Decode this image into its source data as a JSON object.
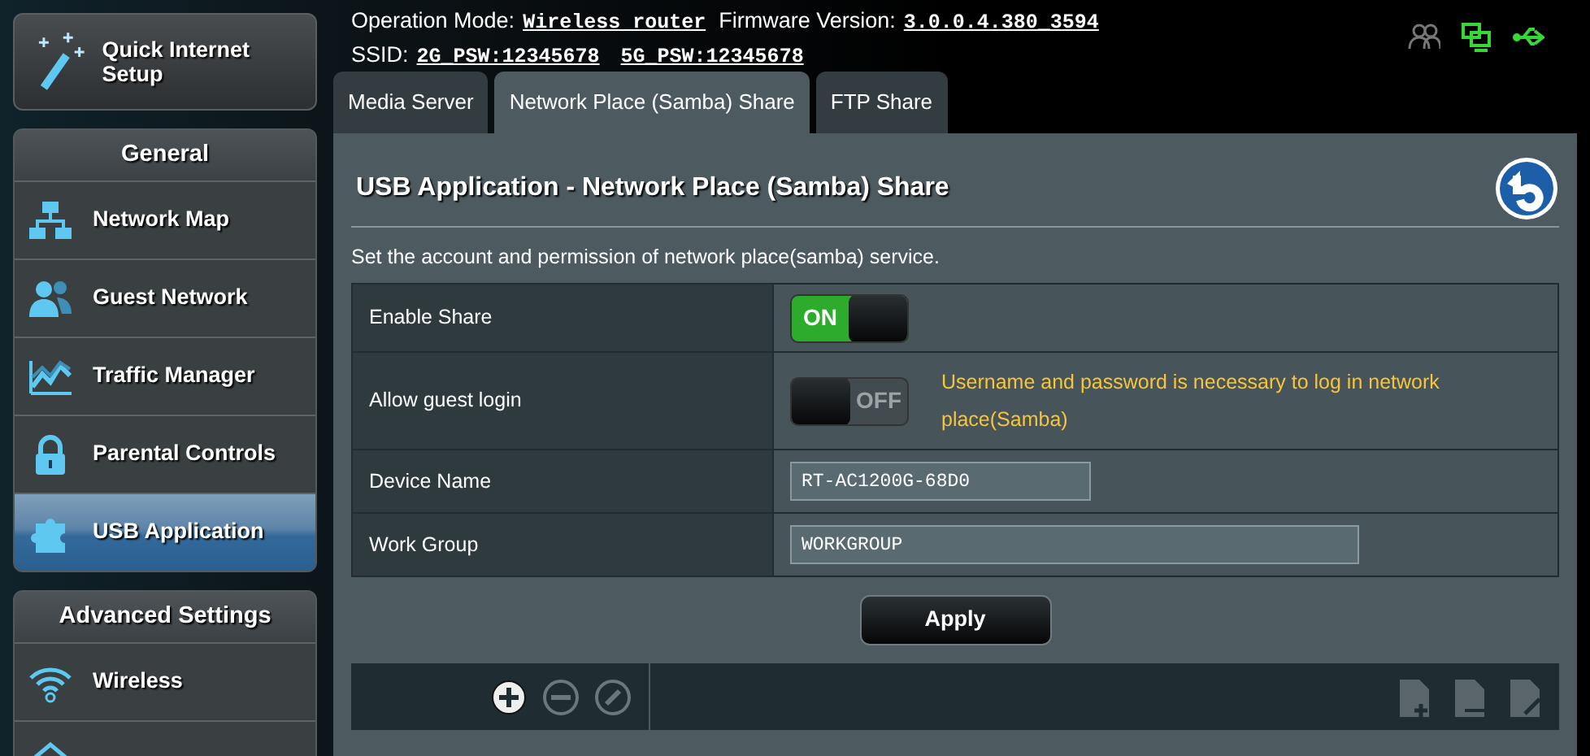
{
  "header": {
    "mode_label": "Operation Mode:",
    "mode_value": "Wireless router",
    "firmware_label": "Firmware Version:",
    "firmware_value": "3.0.0.4.380_3594",
    "ssid_label": "SSID:",
    "ssids": [
      "2G_PSW:12345678",
      "5G_PSW:12345678"
    ],
    "status_icons": [
      {
        "connected": false
      },
      {
        "connected": true
      },
      {
        "connected": true
      }
    ]
  },
  "sidebar": {
    "quick_setup": "Quick Internet Setup",
    "sections": [
      {
        "title": "General",
        "items": [
          {
            "label": "Network Map",
            "selected": false
          },
          {
            "label": "Guest Network",
            "selected": false
          },
          {
            "label": "Traffic Manager",
            "selected": false
          },
          {
            "label": "Parental Controls",
            "selected": false
          },
          {
            "label": "USB Application",
            "selected": true
          }
        ]
      },
      {
        "title": "Advanced Settings",
        "items": [
          {
            "label": "Wireless",
            "selected": false
          },
          {
            "selected": false
          }
        ]
      }
    ]
  },
  "tabs": [
    {
      "label": "Media Server",
      "selected": false
    },
    {
      "label": "Network Place (Samba) Share",
      "selected": true
    },
    {
      "label": "FTP Share",
      "selected": false
    }
  ],
  "panel": {
    "title": "USB Application - Network Place (Samba) Share",
    "description": "Set the account and permission of network place(samba) service.",
    "settings": [
      {
        "kind": "toggle",
        "label": "Enable Share",
        "on": true,
        "state_text": "ON"
      },
      {
        "kind": "toggle",
        "label": "Allow guest login",
        "on": false,
        "state_text": "OFF",
        "hint": "Username and password is necessary to log in network place(Samba)"
      },
      {
        "kind": "input",
        "label": "Device Name",
        "value": "RT-AC1200G-68D0"
      },
      {
        "kind": "input",
        "label": "Work Group",
        "value": "WORKGROUP"
      }
    ],
    "apply": "Apply",
    "account_tools": [
      {
        "disabled": false
      },
      {
        "disabled": true
      },
      {
        "disabled": true
      }
    ]
  }
}
